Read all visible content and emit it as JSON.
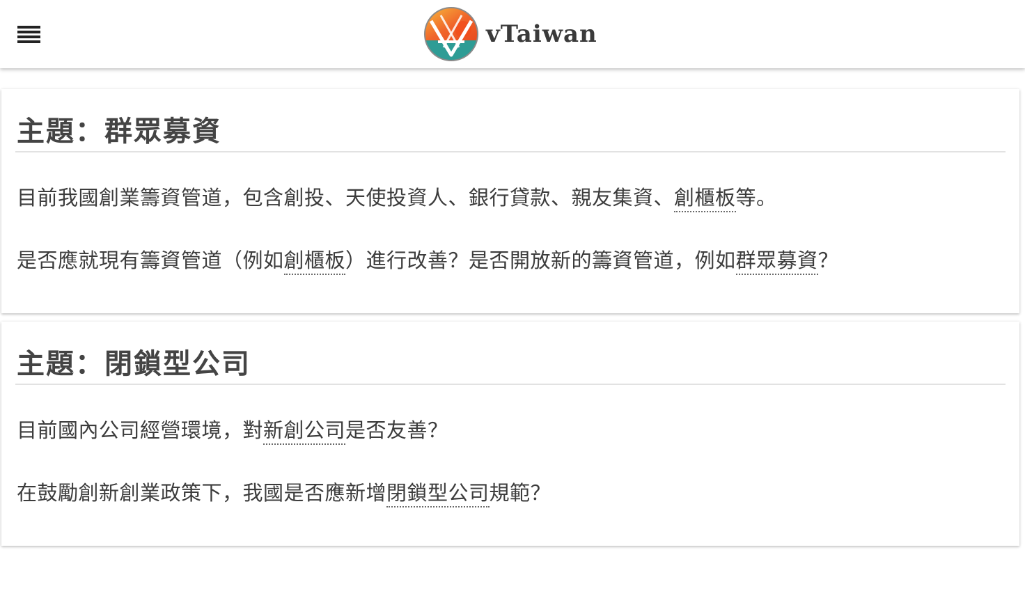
{
  "header": {
    "menu_icon": "hamburger-menu-icon",
    "logo_icon": "vtaiwan-logo-icon",
    "brand": "vTaiwan",
    "colors": {
      "logo_orange": "#f0642a",
      "logo_yellow": "#f6b93b",
      "logo_teal": "#2e9c95"
    }
  },
  "topics": [
    {
      "title": "主題：群眾募資",
      "paragraph1": {
        "before": "目前我國創業籌資管道，包含創投、天使投資人、銀行貸款、親友集資、",
        "term": "創櫃板",
        "after": "等。"
      },
      "paragraph2": {
        "before": "是否應就現有籌資管道（例如",
        "term1": "創櫃板",
        "middle": "）進行改善？是否開放新的籌資管道，例如",
        "term2": "群眾募資",
        "after": "？"
      }
    },
    {
      "title": "主題：閉鎖型公司",
      "paragraph1": {
        "before": "目前國內公司經營環境，對",
        "term": "新創公司",
        "after": "是否友善？"
      },
      "paragraph2": {
        "before": "在鼓勵創新創業政策下，我國是否應新增",
        "term": "閉鎖型公司",
        "after": "規範？"
      }
    }
  ]
}
